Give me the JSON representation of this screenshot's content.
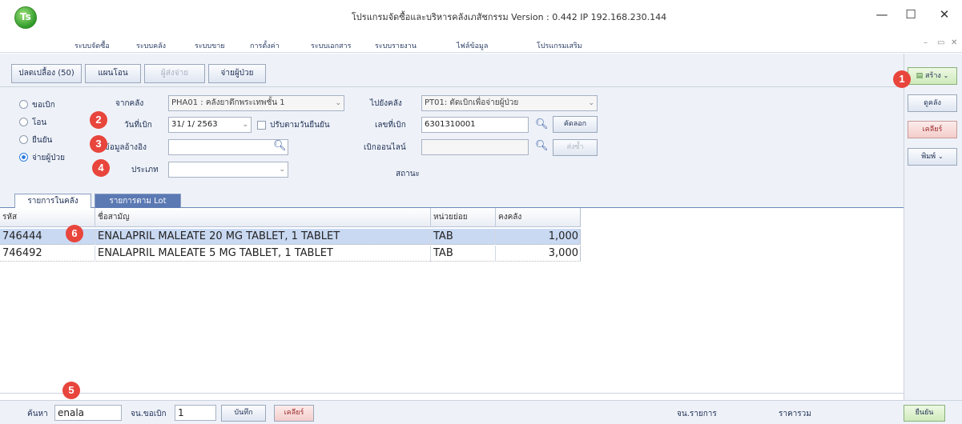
{
  "window": {
    "title": "โปรแกรมจัดซื้อและบริหารคลังเภสัชกรรม Version : 0.442  IP 192.168.230.144",
    "minimize": "—",
    "maximize": "☐",
    "close": "✕"
  },
  "menu": [
    "ระบบจัดซื้อ",
    "ระบบคลัง",
    "ระบบขาย",
    "การตั้งค่า",
    "ระบบเอกสาร",
    "ระบบรายงาน",
    "ไฟล์ข้อมูล",
    "โปรแกรมเสริม"
  ],
  "toolbar": {
    "tabs": [
      "ปลดเปลื้อง (50)",
      "แผนโอน",
      "ผู้ส่งจ่าย",
      "จ่ายผู้ป่วย"
    ]
  },
  "side": {
    "create": "สร้าง",
    "find": "ดูคลัง",
    "clear": "เคลียร์",
    "print": "พิมพ์"
  },
  "form": {
    "radios": [
      "ขอเบิก",
      "โอน",
      "ยืนยัน",
      "จ่ายผู้ป่วย"
    ],
    "from_label": "จากคลัง",
    "from_value": "PHA01 : คลังยาตึกพระเทพชั้น 1",
    "to_label": "ไปยังคลัง",
    "to_value": "PT01: ตัดเบิกเพื่อจ่ายผู้ป่วย",
    "date_label": "วันที่เบิก",
    "date_value": "31/ 1/ 2563",
    "adjust_label": "ปรับตามวันยืนยัน",
    "docno_label": "เลขที่เบิก",
    "docno_value": "6301310001",
    "copy_btn": "คัดลอก",
    "ref_label": "ข้อมูลอ้างอิง",
    "online_label": "เบิกออนไลน์",
    "send_btn": "ส่งซ้ำ",
    "type_label": "ประเภท",
    "status_label": "สถานะ"
  },
  "tabs": [
    "รายการในคลัง",
    "รายการตาม Lot"
  ],
  "grid": {
    "headers": [
      "รหัส",
      "ชื่อสามัญ",
      "หน่วยย่อย",
      "คงคลัง"
    ],
    "rows": [
      {
        "code": "746444",
        "name": "ENALAPRIL MALEATE 20 MG TABLET, 1 TABLET",
        "unit": "TAB",
        "stock": "1,000"
      },
      {
        "code": "746492",
        "name": "ENALAPRIL MALEATE 5 MG TABLET, 1 TABLET",
        "unit": "TAB",
        "stock": "3,000"
      }
    ]
  },
  "bottom": {
    "search_label": "ค้นหา",
    "search_value": "enala",
    "qty_label": "จน.ขอเบิก",
    "qty_value": "1",
    "save_btn": "บันทึก",
    "clear_btn": "เคลียร์",
    "items_label": "จน.รายการ",
    "total_label": "ราคารวม",
    "confirm_btn": "ยืนยัน"
  },
  "callouts": [
    "1",
    "2",
    "3",
    "4",
    "5",
    "6"
  ],
  "colors": {
    "badge": "#e8453c",
    "selected_row": "#c9d9f2",
    "tab_active": "#5b79b3"
  }
}
